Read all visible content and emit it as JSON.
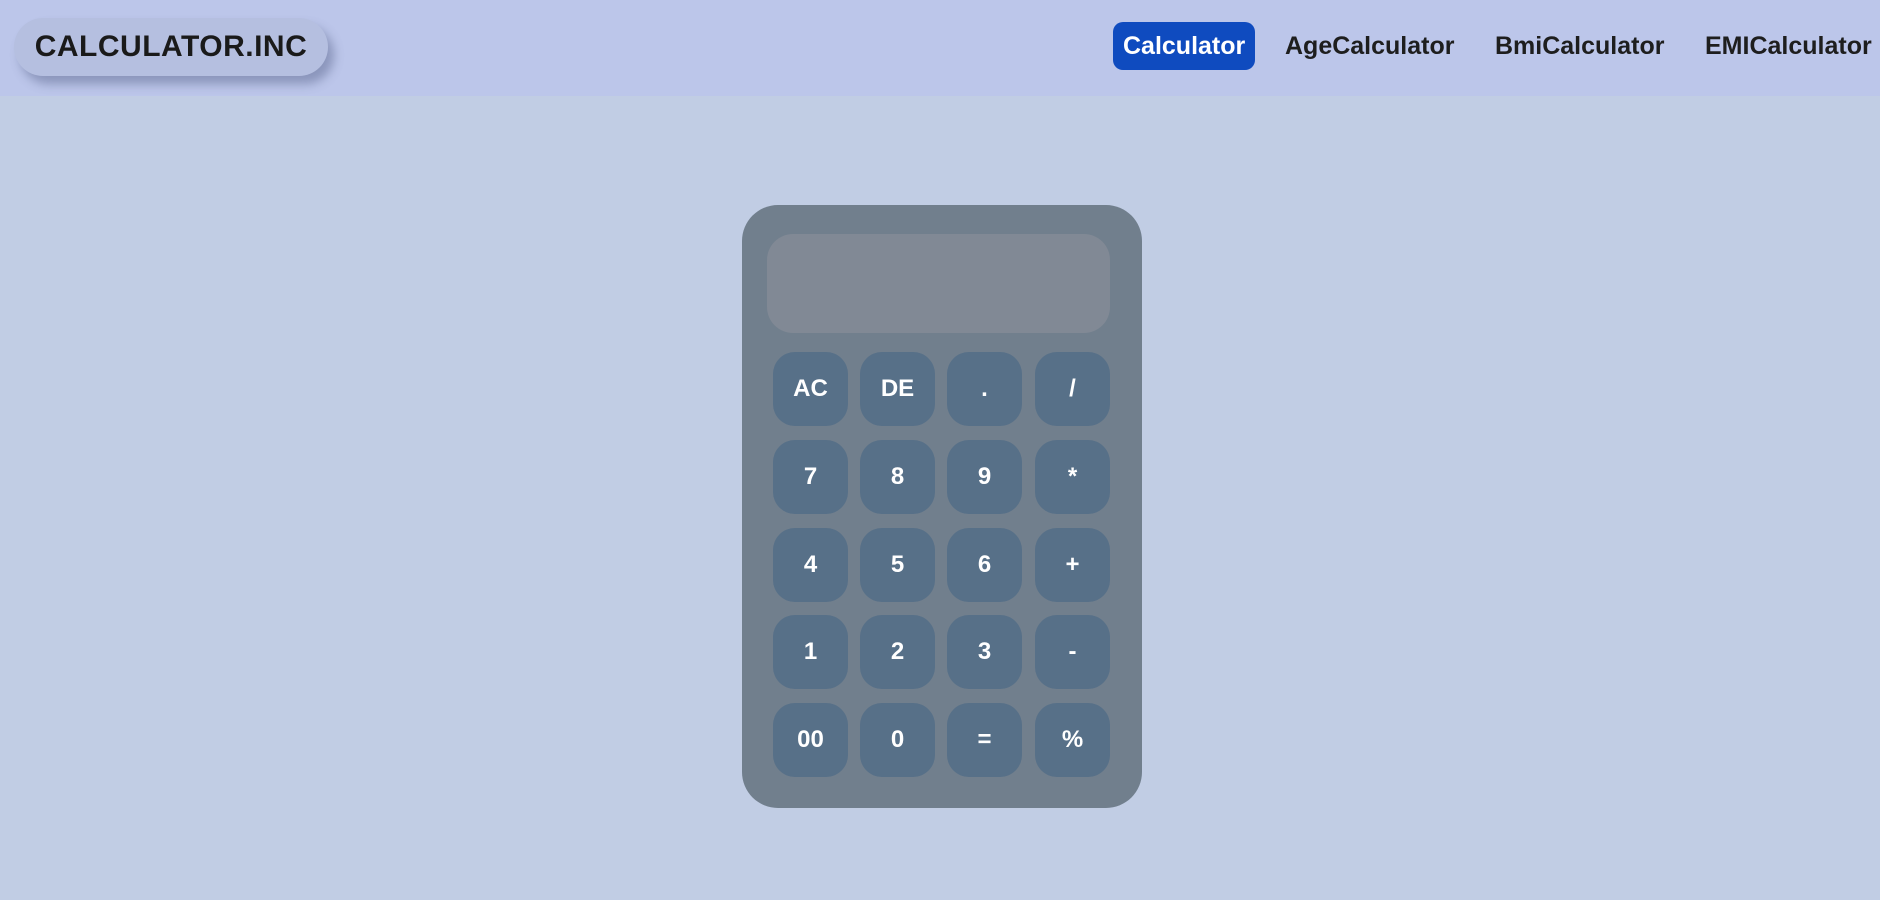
{
  "header": {
    "logo": "CALCULATOR.INC",
    "nav": [
      {
        "label": "Calculator",
        "active": true
      },
      {
        "label": "AgeCalculator",
        "active": false
      },
      {
        "label": "BmiCalculator",
        "active": false
      },
      {
        "label": "EMICalculator",
        "active": false
      }
    ]
  },
  "calculator": {
    "display": "",
    "buttons": [
      "AC",
      "DE",
      ".",
      "/",
      "7",
      "8",
      "9",
      "*",
      "4",
      "5",
      "6",
      "+",
      "1",
      "2",
      "3",
      "-",
      "00",
      "0",
      "=",
      "%"
    ]
  },
  "colors": {
    "header_bg": "#bcc6ea",
    "page_bg": "#c1cde4",
    "calc_body": "#717f8d",
    "button": "#577088",
    "nav_active": "#0f4bbf"
  }
}
